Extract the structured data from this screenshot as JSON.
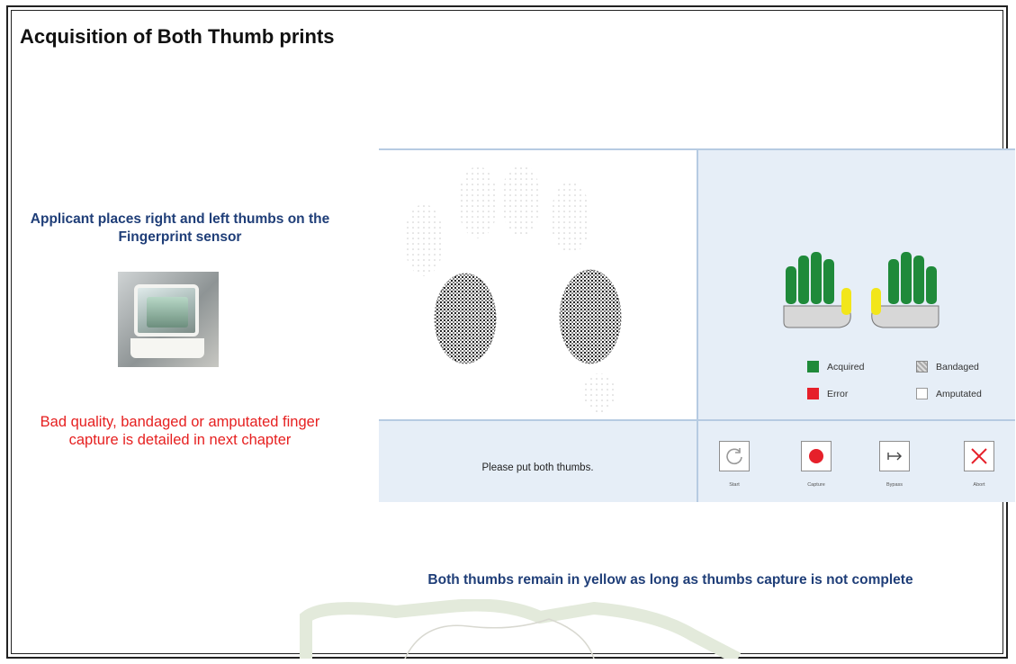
{
  "slide": {
    "title": "Acquisition of Both Thumb prints",
    "applicant_text": "Applicant places right and left thumbs on the Fingerprint sensor",
    "bad_quality_text": "Bad quality, bandaged or amputated finger capture is detailed in next chapter",
    "bottom_caption": "Both thumbs remain in yellow as long as thumbs capture is not complete"
  },
  "app": {
    "status_message": "Please put both thumbs.",
    "legend": [
      {
        "label": "Acquired",
        "color": "#1f8a3a"
      },
      {
        "label": "Bandaged",
        "color": "#b5b5b5"
      },
      {
        "label": "Error",
        "color": "#e6202a"
      },
      {
        "label": "Amputated",
        "color": "#ffffff"
      }
    ],
    "controls": [
      {
        "label": "Start",
        "icon": "restart-icon"
      },
      {
        "label": "Capture",
        "icon": "record-icon"
      },
      {
        "label": "Bypass",
        "icon": "arrow-to-bar-icon"
      },
      {
        "label": "Abort",
        "icon": "close-icon"
      }
    ],
    "colors": {
      "finger_acquired": "#1f8a3a",
      "thumb_pending": "#f2e61a",
      "palm": "#d7d7d7",
      "panel_bg": "#e6eef7",
      "accent_text": "#1f3e78",
      "error_text": "#e62020"
    }
  }
}
